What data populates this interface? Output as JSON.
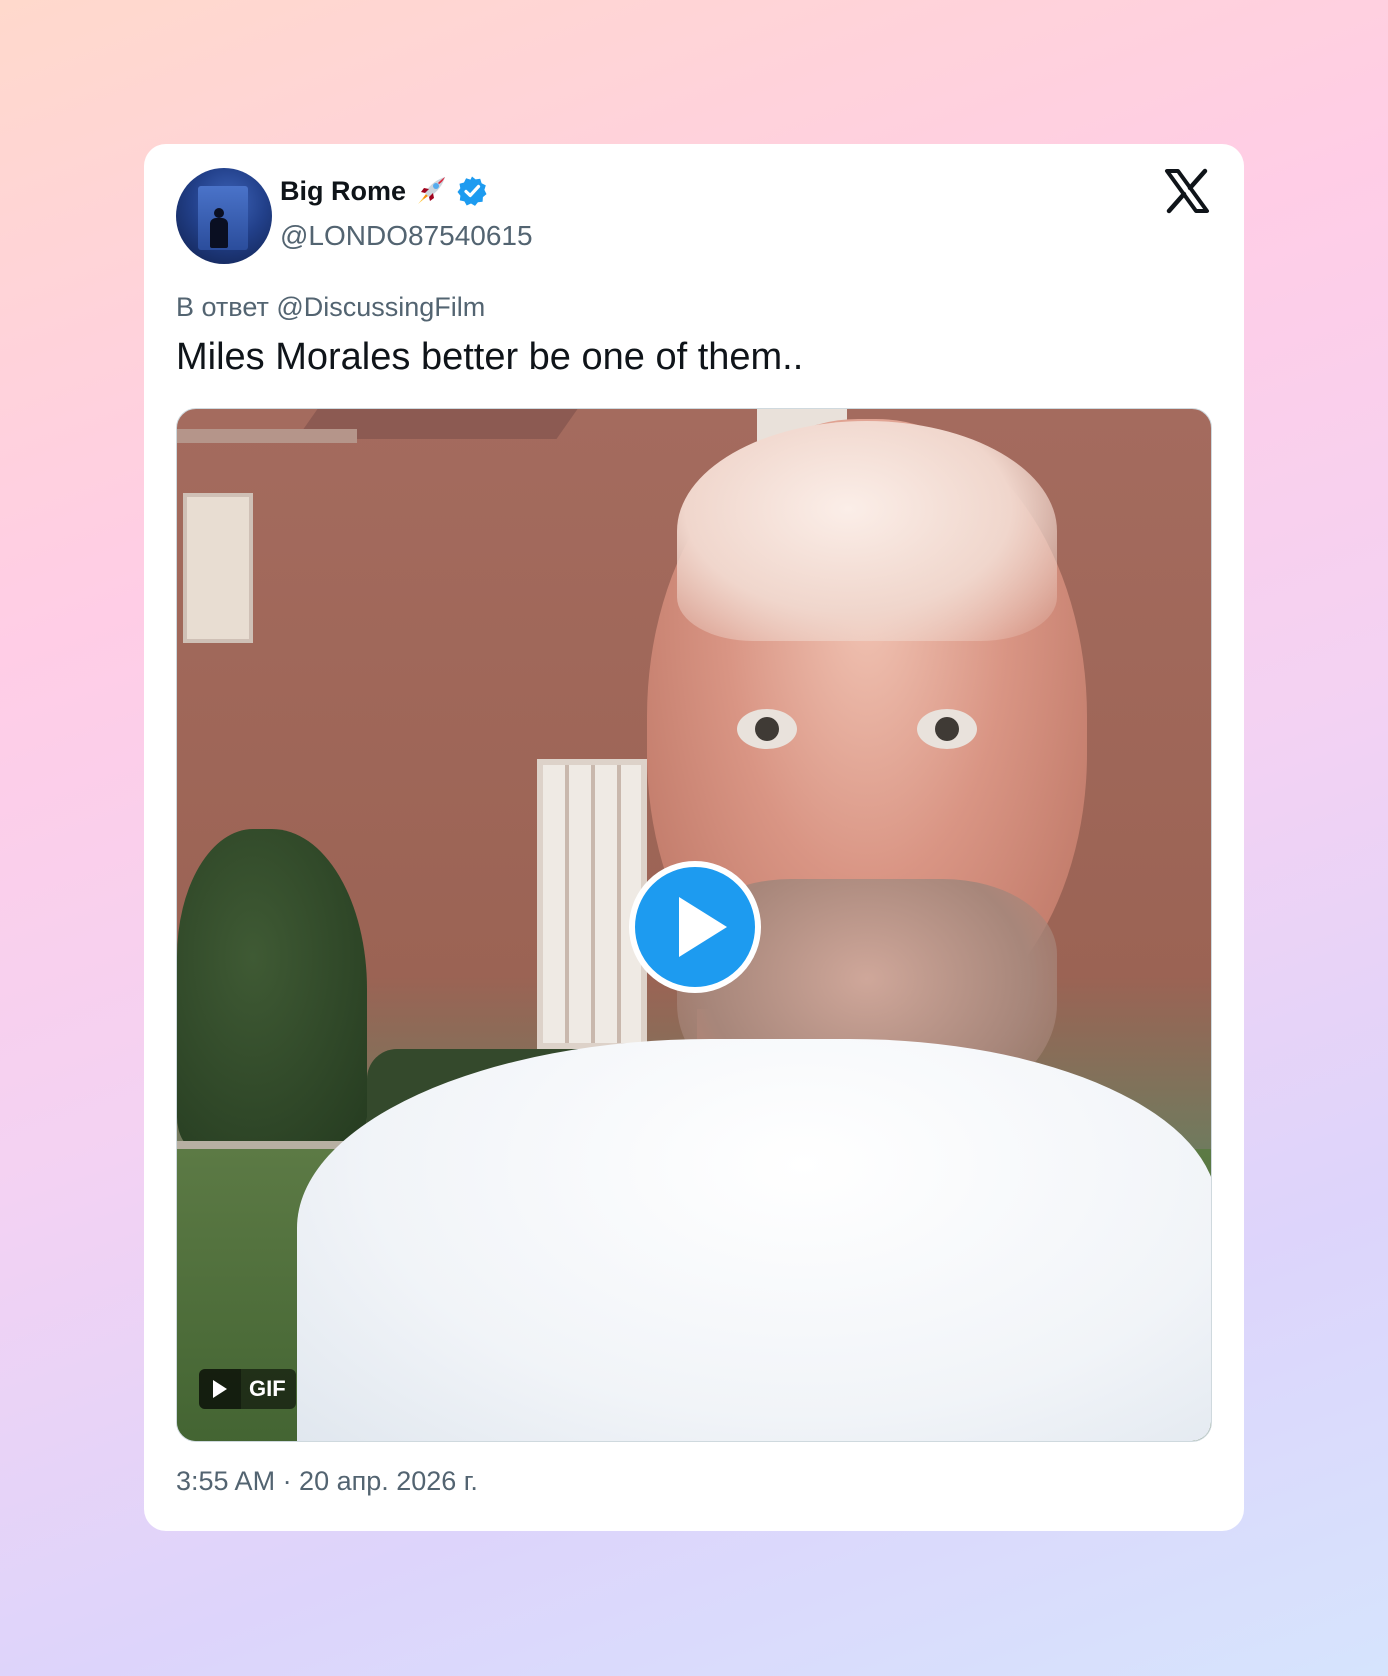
{
  "tweet": {
    "author_name": "Big Rome",
    "author_handle": "@LONDO87540615",
    "name_emoji": "rocket",
    "verified": true,
    "reply_prefix": "В ответ",
    "reply_mention": "@DiscussingFilm",
    "text": "Miles Morales better be one of them..",
    "timestamp": "3:55 AM · 20 апр. 2026 г."
  },
  "media": {
    "type": "gif",
    "badge_label": "GIF",
    "play_icon": "play-icon"
  },
  "brand": {
    "logo": "x-logo",
    "accent_color": "#1d9bf0",
    "text_color": "#0f1419",
    "secondary_text_color": "#536471"
  }
}
